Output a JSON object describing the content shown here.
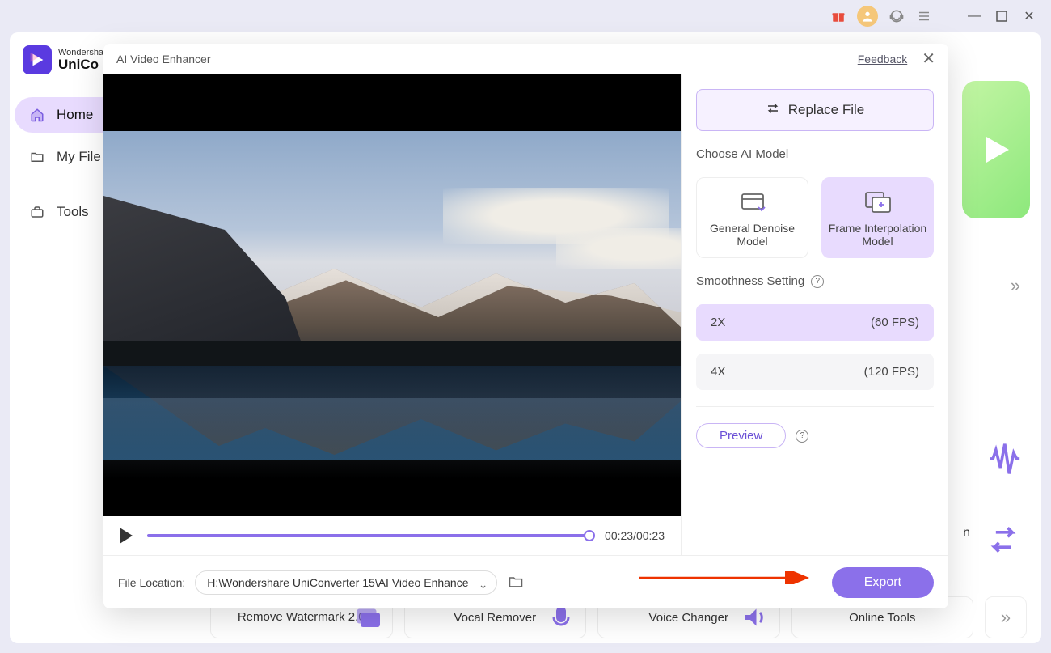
{
  "app": {
    "brand_top": "Wondershare",
    "brand_bottom": "UniCo"
  },
  "sidebar": {
    "items": [
      {
        "label": "Home"
      },
      {
        "label": "My File"
      },
      {
        "label": "Tools"
      }
    ]
  },
  "bg_tools": [
    {
      "label": "Remove Watermark 2.0"
    },
    {
      "label": "Vocal Remover"
    },
    {
      "label": "Voice Changer"
    },
    {
      "label": "Online Tools"
    }
  ],
  "bg_partial_text": "n",
  "modal": {
    "title": "AI Video Enhancer",
    "feedback": "Feedback",
    "replace_label": "Replace File",
    "choose_model_label": "Choose AI Model",
    "models": [
      {
        "label": "General Denoise Model"
      },
      {
        "label": "Frame Interpolation Model"
      }
    ],
    "smoothness_label": "Smoothness Setting",
    "smoothness": [
      {
        "mult": "2X",
        "fps": "(60 FPS)"
      },
      {
        "mult": "4X",
        "fps": "(120 FPS)"
      }
    ],
    "preview_label": "Preview",
    "time": "00:23/00:23",
    "file_location_label": "File Location:",
    "file_location_value": "H:\\Wondershare UniConverter 15\\AI Video Enhance",
    "export_label": "Export"
  },
  "colors": {
    "accent": "#8b70ea",
    "accent_light": "#e8dbfe",
    "green": "#9de88a"
  }
}
